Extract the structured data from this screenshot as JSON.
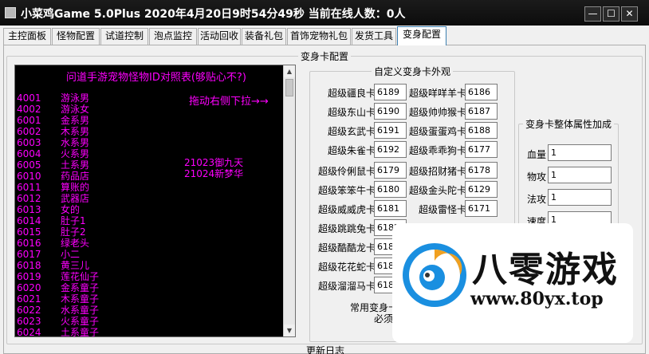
{
  "window": {
    "title": "小菜鸡Game 5.0Plus  2020年4月20日9时54分49秒  当前在线人数：0人",
    "minimize": "—",
    "maximize": "☐",
    "close": "✕"
  },
  "tabs": [
    {
      "label": "主控面板"
    },
    {
      "label": "怪物配置"
    },
    {
      "label": "试道控制"
    },
    {
      "label": "泡点监控"
    },
    {
      "label": "活动回收"
    },
    {
      "label": "装备礼包"
    },
    {
      "label": "首饰宠物礼包"
    },
    {
      "label": "发货工具"
    },
    {
      "label": "变身配置"
    }
  ],
  "main": {
    "group_title": "变身卡配置",
    "listbox": {
      "header": "问道手游宠物怪物ID对照表(够贴心不?)",
      "hint": "拖动右侧下拉→→",
      "rows": [
        {
          "id": "4001",
          "name": "游泳男"
        },
        {
          "id": "4002",
          "name": "游泳女"
        },
        {
          "id": "6001",
          "name": "金系男"
        },
        {
          "id": "6002",
          "name": "木系男"
        },
        {
          "id": "6003",
          "name": "水系男"
        },
        {
          "id": "6004",
          "name": "火系男"
        },
        {
          "id": "6005",
          "name": "土系男"
        },
        {
          "id": "6010",
          "name": "药品店"
        },
        {
          "id": "6011",
          "name": "算账的"
        },
        {
          "id": "6012",
          "name": "武器店"
        },
        {
          "id": "6013",
          "name": "女的"
        },
        {
          "id": "6014",
          "name": "肚子1"
        },
        {
          "id": "6015",
          "name": "肚子2"
        },
        {
          "id": "6016",
          "name": "绿老头"
        },
        {
          "id": "6017",
          "name": "小二"
        },
        {
          "id": "6018",
          "name": "黄三儿"
        },
        {
          "id": "6019",
          "name": "莲花仙子"
        },
        {
          "id": "6020",
          "name": "金系童子"
        },
        {
          "id": "6021",
          "name": "木系童子"
        },
        {
          "id": "6022",
          "name": "水系童子"
        },
        {
          "id": "6023",
          "name": "火系童子"
        },
        {
          "id": "6024",
          "name": "土系童子"
        }
      ],
      "extras": [
        "21023御九天",
        "21024新梦华"
      ]
    },
    "custom_group": {
      "title": "自定义变身卡外观",
      "left_cards": [
        {
          "label": "超级疆良卡",
          "value": "6189"
        },
        {
          "label": "超级东山卡",
          "value": "6190"
        },
        {
          "label": "超级玄武卡",
          "value": "6191"
        },
        {
          "label": "超级朱雀卡",
          "value": "6192"
        },
        {
          "label": "超级伶俐鼠卡",
          "value": "6179"
        },
        {
          "label": "超级笨笨牛卡",
          "value": "6180"
        },
        {
          "label": "超级威威虎卡",
          "value": "6181"
        },
        {
          "label": "超级跳跳兔卡",
          "value": "6182"
        },
        {
          "label": "超级酷酷龙卡",
          "value": "6183"
        },
        {
          "label": "超级花花蛇卡",
          "value": "6184"
        },
        {
          "label": "超级溜溜马卡",
          "value": "6185"
        }
      ],
      "right_cards": [
        {
          "label": "超级咩咩羊卡",
          "value": "6186"
        },
        {
          "label": "超级帅帅猴卡",
          "value": "6187"
        },
        {
          "label": "超级蛋蛋鸡卡",
          "value": "6188"
        },
        {
          "label": "超级乖乖狗卡",
          "value": "6177"
        },
        {
          "label": "超级招财猪卡",
          "value": "6178"
        },
        {
          "label": "超级金头陀卡",
          "value": "6129"
        },
        {
          "label": "超级雷怪卡",
          "value": "6171"
        }
      ],
      "common_label": "常用变身卡",
      "required_label": "必须"
    },
    "attr_group": {
      "title": "变身卡整体属性加成",
      "fields": [
        {
          "label": "血量",
          "value": "1"
        },
        {
          "label": "物攻",
          "value": "1"
        },
        {
          "label": "法攻",
          "value": "1"
        },
        {
          "label": "速度",
          "value": "1"
        }
      ]
    },
    "footer": "更新日志"
  },
  "watermark": {
    "title": "八零游戏",
    "url": "www.80yx.top"
  }
}
